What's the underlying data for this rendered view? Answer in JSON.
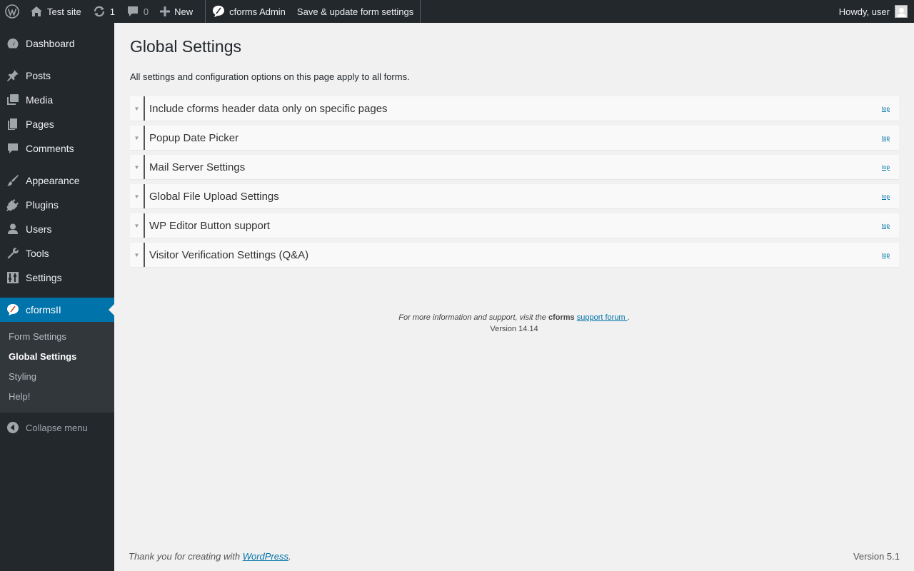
{
  "admin_bar": {
    "wp_logo_icon": "wordpress-logo-icon",
    "site_name": "Test site",
    "updates_count": "1",
    "comments_count": "0",
    "new_label": "New",
    "cforms_admin_label": "cforms Admin",
    "save_label": "Save & update form settings",
    "howdy_label": "Howdy, user"
  },
  "sidebar": {
    "items": [
      {
        "label": "Dashboard",
        "icon": "dashboard-icon"
      },
      {
        "label": "Posts",
        "icon": "pin-icon"
      },
      {
        "label": "Media",
        "icon": "media-icon"
      },
      {
        "label": "Pages",
        "icon": "pages-icon"
      },
      {
        "label": "Comments",
        "icon": "comment-icon"
      },
      {
        "label": "Appearance",
        "icon": "brush-icon"
      },
      {
        "label": "Plugins",
        "icon": "plugin-icon"
      },
      {
        "label": "Users",
        "icon": "user-icon"
      },
      {
        "label": "Tools",
        "icon": "wrench-icon"
      },
      {
        "label": "Settings",
        "icon": "settings-sliders-icon"
      },
      {
        "label": "cformsII",
        "icon": "cforms-icon"
      }
    ],
    "submenu": [
      "Form Settings",
      "Global Settings",
      "Styling",
      "Help!"
    ],
    "collapse_label": "Collapse menu"
  },
  "main": {
    "title": "Global Settings",
    "intro": "All settings and configuration options on this page apply to all forms.",
    "sections": [
      "Include cforms header data only on specific pages",
      "Popup Date Picker",
      "Mail Server Settings",
      "Global File Upload Settings",
      "WP Editor Button support",
      "Visitor Verification Settings (Q&A)"
    ],
    "top_link": "top",
    "toggle_glyph": "▼",
    "support_prefix": "For more information and support, visit the",
    "support_brand": "cforms",
    "support_link": "support forum ",
    "support_suffix": ".",
    "version_line": "Version 14.14"
  },
  "footer": {
    "thanks_prefix": "Thank you for creating with",
    "wp_link": "WordPress",
    "thanks_suffix": ".",
    "version": "Version 5.1"
  },
  "colors": {
    "adminbar_bg": "#23282d",
    "sidebar_bg": "#23282d",
    "submenu_bg": "#32373c",
    "accent": "#0073aa",
    "content_bg": "#f1f1f1"
  }
}
